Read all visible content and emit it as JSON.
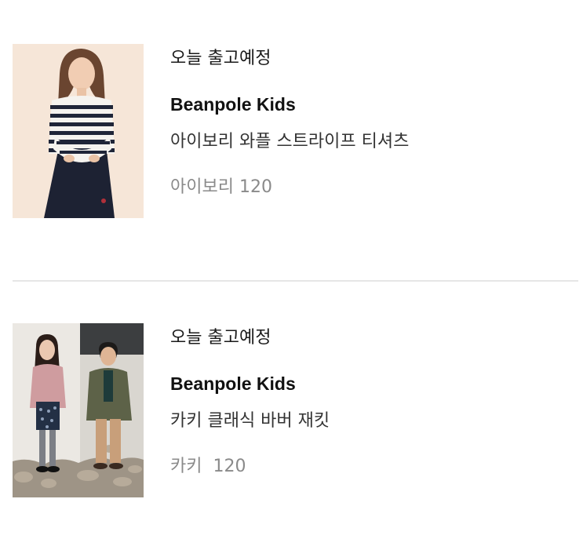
{
  "orders": [
    {
      "ship_status": "오늘 출고예정",
      "brand": "Beanpole Kids",
      "product_name": "아이보리 와플 스트라이프 티셔츠",
      "option": "아이보리 120"
    },
    {
      "ship_status": "오늘 출고예정",
      "brand": "Beanpole Kids",
      "product_name": "카키 클래식 바버 재킷",
      "option": "카키  120"
    }
  ]
}
